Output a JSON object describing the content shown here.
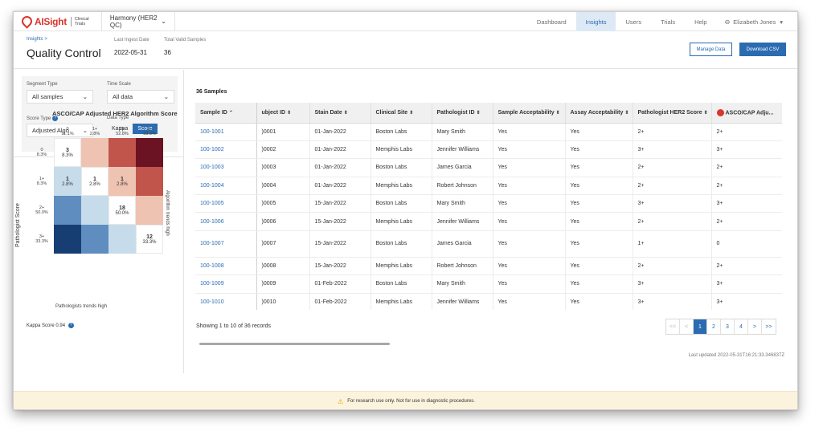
{
  "app": {
    "brand_main": "AISight",
    "brand_sub": "Clinical Trials",
    "study": "Harmony (HER2 QC)"
  },
  "nav": {
    "items": [
      "Dashboard",
      "Insights",
      "Users",
      "Trials",
      "Help"
    ],
    "active": "Insights",
    "user": "Elizabeth Jones"
  },
  "header": {
    "breadcrumb": "Insights  >",
    "title": "Quality Control",
    "ingest_label": "Last Ingest Date",
    "ingest_value": "2022-05-31",
    "valid_label": "Total Valid Samples",
    "valid_value": "36",
    "manage_label": "Manage Data",
    "download_label": "Download CSV"
  },
  "filters": {
    "segment_label": "Segment Type",
    "segment_value": "All samples",
    "time_label": "Time Scale",
    "time_value": "All data",
    "score_label": "Score Type",
    "score_value": "Adjusted Algo",
    "data_label": "Data Type",
    "data_options": [
      "Kappa",
      "Score"
    ],
    "data_selected": "Score"
  },
  "matrix": {
    "title": "ASCO/CAP Adjusted HER2 Algorithm Score",
    "columns": [
      {
        "label": "0",
        "pct": "11.1%"
      },
      {
        "label": "1+",
        "pct": "2.8%"
      },
      {
        "label": "2+",
        "pct": "52.8%"
      },
      {
        "label": "3+",
        "pct": "33.3%"
      }
    ],
    "rows": [
      {
        "label": "0",
        "pct": "8.3%"
      },
      {
        "label": "1+",
        "pct": "8.3%"
      },
      {
        "label": "2+",
        "pct": "50.0%"
      },
      {
        "label": "3+",
        "pct": "33.3%"
      }
    ],
    "cells": [
      [
        {
          "count": "3",
          "pct": "8.3%",
          "color": "#ffffff"
        },
        {
          "count": "",
          "pct": "",
          "color": "#efc3b2"
        },
        {
          "count": "",
          "pct": "",
          "color": "#c1554c"
        },
        {
          "count": "",
          "pct": "",
          "color": "#6b1323"
        }
      ],
      [
        {
          "count": "1",
          "pct": "2.8%",
          "color": "#c7dcea"
        },
        {
          "count": "1",
          "pct": "2.8%",
          "color": "#ffffff"
        },
        {
          "count": "1",
          "pct": "2.8%",
          "color": "#efc3b2"
        },
        {
          "count": "",
          "pct": "",
          "color": "#c1554c"
        }
      ],
      [
        {
          "count": "",
          "pct": "",
          "color": "#5f8dc0"
        },
        {
          "count": "",
          "pct": "",
          "color": "#c7dcea"
        },
        {
          "count": "18",
          "pct": "50.0%",
          "color": "#ffffff"
        },
        {
          "count": "",
          "pct": "",
          "color": "#efc3b2"
        }
      ],
      [
        {
          "count": "",
          "pct": "",
          "color": "#173e73"
        },
        {
          "count": "",
          "pct": "",
          "color": "#5f8dc0"
        },
        {
          "count": "",
          "pct": "",
          "color": "#c7dcea"
        },
        {
          "count": "12",
          "pct": "33.3%",
          "color": "#ffffff"
        }
      ]
    ],
    "y_label": "Pathologist Score",
    "right_label": "Algorithm trends high",
    "bottom_label": "Pathologists trends high",
    "kappa_label": "Kappa Score 0.94"
  },
  "table": {
    "title": "36 Samples",
    "headers": [
      "Sample ID",
      "ubject ID",
      "Stain Date",
      "Clinical Site",
      "Pathologist ID",
      "Sample Acceptability",
      "Assay Acceptability",
      "Pathologist HER2 Score",
      "ASCO/CAP Adju..."
    ],
    "rows": [
      [
        "100-1001",
        ")0001",
        "01-Jan-2022",
        "Boston Labs",
        "Mary Smith",
        "Yes",
        "Yes",
        "2+",
        "2+"
      ],
      [
        "100-1002",
        ")0002",
        "01-Jan-2022",
        "Memphis Labs",
        "Jennifer Williams",
        "Yes",
        "Yes",
        "3+",
        "3+"
      ],
      [
        "100-1003",
        ")0003",
        "01-Jan-2022",
        "Boston Labs",
        "James Garcia",
        "Yes",
        "Yes",
        "2+",
        "2+"
      ],
      [
        "100-1004",
        ")0004",
        "01-Jan-2022",
        "Memphis Labs",
        "Robert Johnson",
        "Yes",
        "Yes",
        "2+",
        "2+"
      ],
      [
        "100-1005",
        ")0005",
        "15-Jan-2022",
        "Boston Labs",
        "Mary Smith",
        "Yes",
        "Yes",
        "3+",
        "3+"
      ],
      [
        "100-1006",
        ")0006",
        "15-Jan-2022",
        "Memphis Labs",
        "Jennifer Williams",
        "Yes",
        "Yes",
        "2+",
        "2+"
      ],
      [
        "100-1007",
        ")0007",
        "15-Jan-2022",
        "Boston Labs",
        "James Garcia",
        "Yes",
        "Yes",
        "1+",
        "0"
      ],
      [
        "100-1008",
        ")0008",
        "15-Jan-2022",
        "Memphis Labs",
        "Robert Johnson",
        "Yes",
        "Yes",
        "2+",
        "2+"
      ],
      [
        "100-1009",
        ")0009",
        "01-Feb-2022",
        "Boston Labs",
        "Mary Smith",
        "Yes",
        "Yes",
        "3+",
        "3+"
      ],
      [
        "100-1010",
        ")0010",
        "01-Feb-2022",
        "Memphis Labs",
        "Jennifer Williams",
        "Yes",
        "Yes",
        "3+",
        "3+"
      ]
    ],
    "showing": "Showing 1 to 10 of 36 records",
    "pages": [
      "<<",
      "<",
      "1",
      "2",
      "3",
      "4",
      ">",
      ">>"
    ],
    "current_page": "1",
    "last_updated": "Last updated 2022-05-31T16:21:33.346837Z"
  },
  "footer": {
    "notice": "For research use only. Not for use in diagnostic procedures."
  }
}
